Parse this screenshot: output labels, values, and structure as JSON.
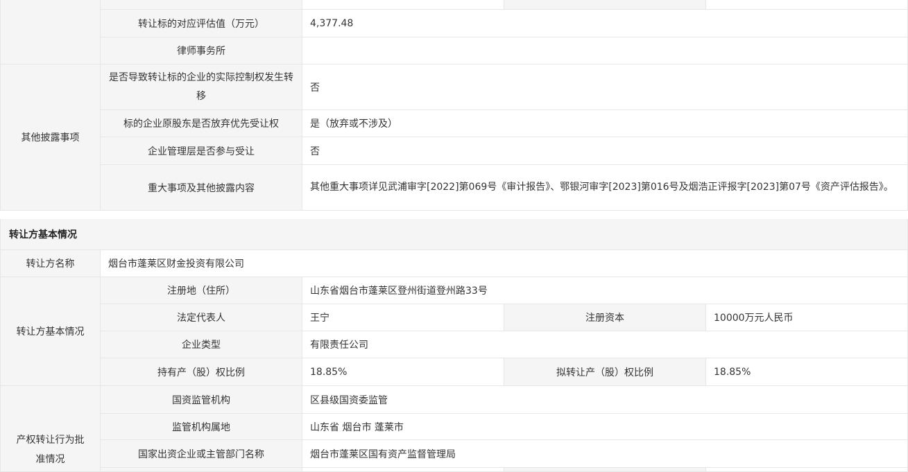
{
  "top_rows": {
    "valuation_label": "转让标的对应评估值（万元）",
    "valuation_value": "4,377.48",
    "law_firm_label": "律师事务所",
    "law_firm_value": ""
  },
  "other_disclosures": {
    "group_label": "其他披露事项",
    "control_change_label": "是否导致转让标的企业的实际控制权发生转移",
    "control_change_value": "否",
    "preemptive_label": "标的企业原股东是否放弃优先受让权",
    "preemptive_value": "是（放弃或不涉及）",
    "management_label": "企业管理层是否参与受让",
    "management_value": "否",
    "major_matters_label": "重大事项及其他披露内容",
    "major_matters_value": "其他重大事项详见武浦审字[2022]第069号《审计报告》、鄂银河审字[2023]第016号及烟浩正评报字[2023]第07号《资产评估报告》。"
  },
  "transferor": {
    "section_title": "转让方基本情况",
    "name_label": "转让方名称",
    "name_value": "烟台市蓬莱区财金投资有限公司",
    "group_label": "转让方基本情况",
    "address_label": "注册地（住所）",
    "address_value": "山东省烟台市蓬莱区登州街道登州路33号",
    "legal_rep_label": "法定代表人",
    "legal_rep_value": "王宁",
    "reg_capital_label": "注册资本",
    "reg_capital_value": "10000万元人民币",
    "company_type_label": "企业类型",
    "company_type_value": "有限责任公司",
    "holding_ratio_label": "持有产（股）权比例",
    "holding_ratio_value": "18.85%",
    "transfer_ratio_label": "拟转让产（股）权比例",
    "transfer_ratio_value": "18.85%"
  },
  "approval": {
    "group_label": "产权转让行为批准情况",
    "agency_label": "国资监管机构",
    "agency_value": "区县级国资委监管",
    "agency_location_label": "监管机构属地",
    "agency_location_value": "山东省 烟台市 蓬莱市",
    "dept_name_label": "国家出资企业或主管部门名称",
    "dept_name_value": "烟台市蓬莱区国有资产监督管理局"
  }
}
